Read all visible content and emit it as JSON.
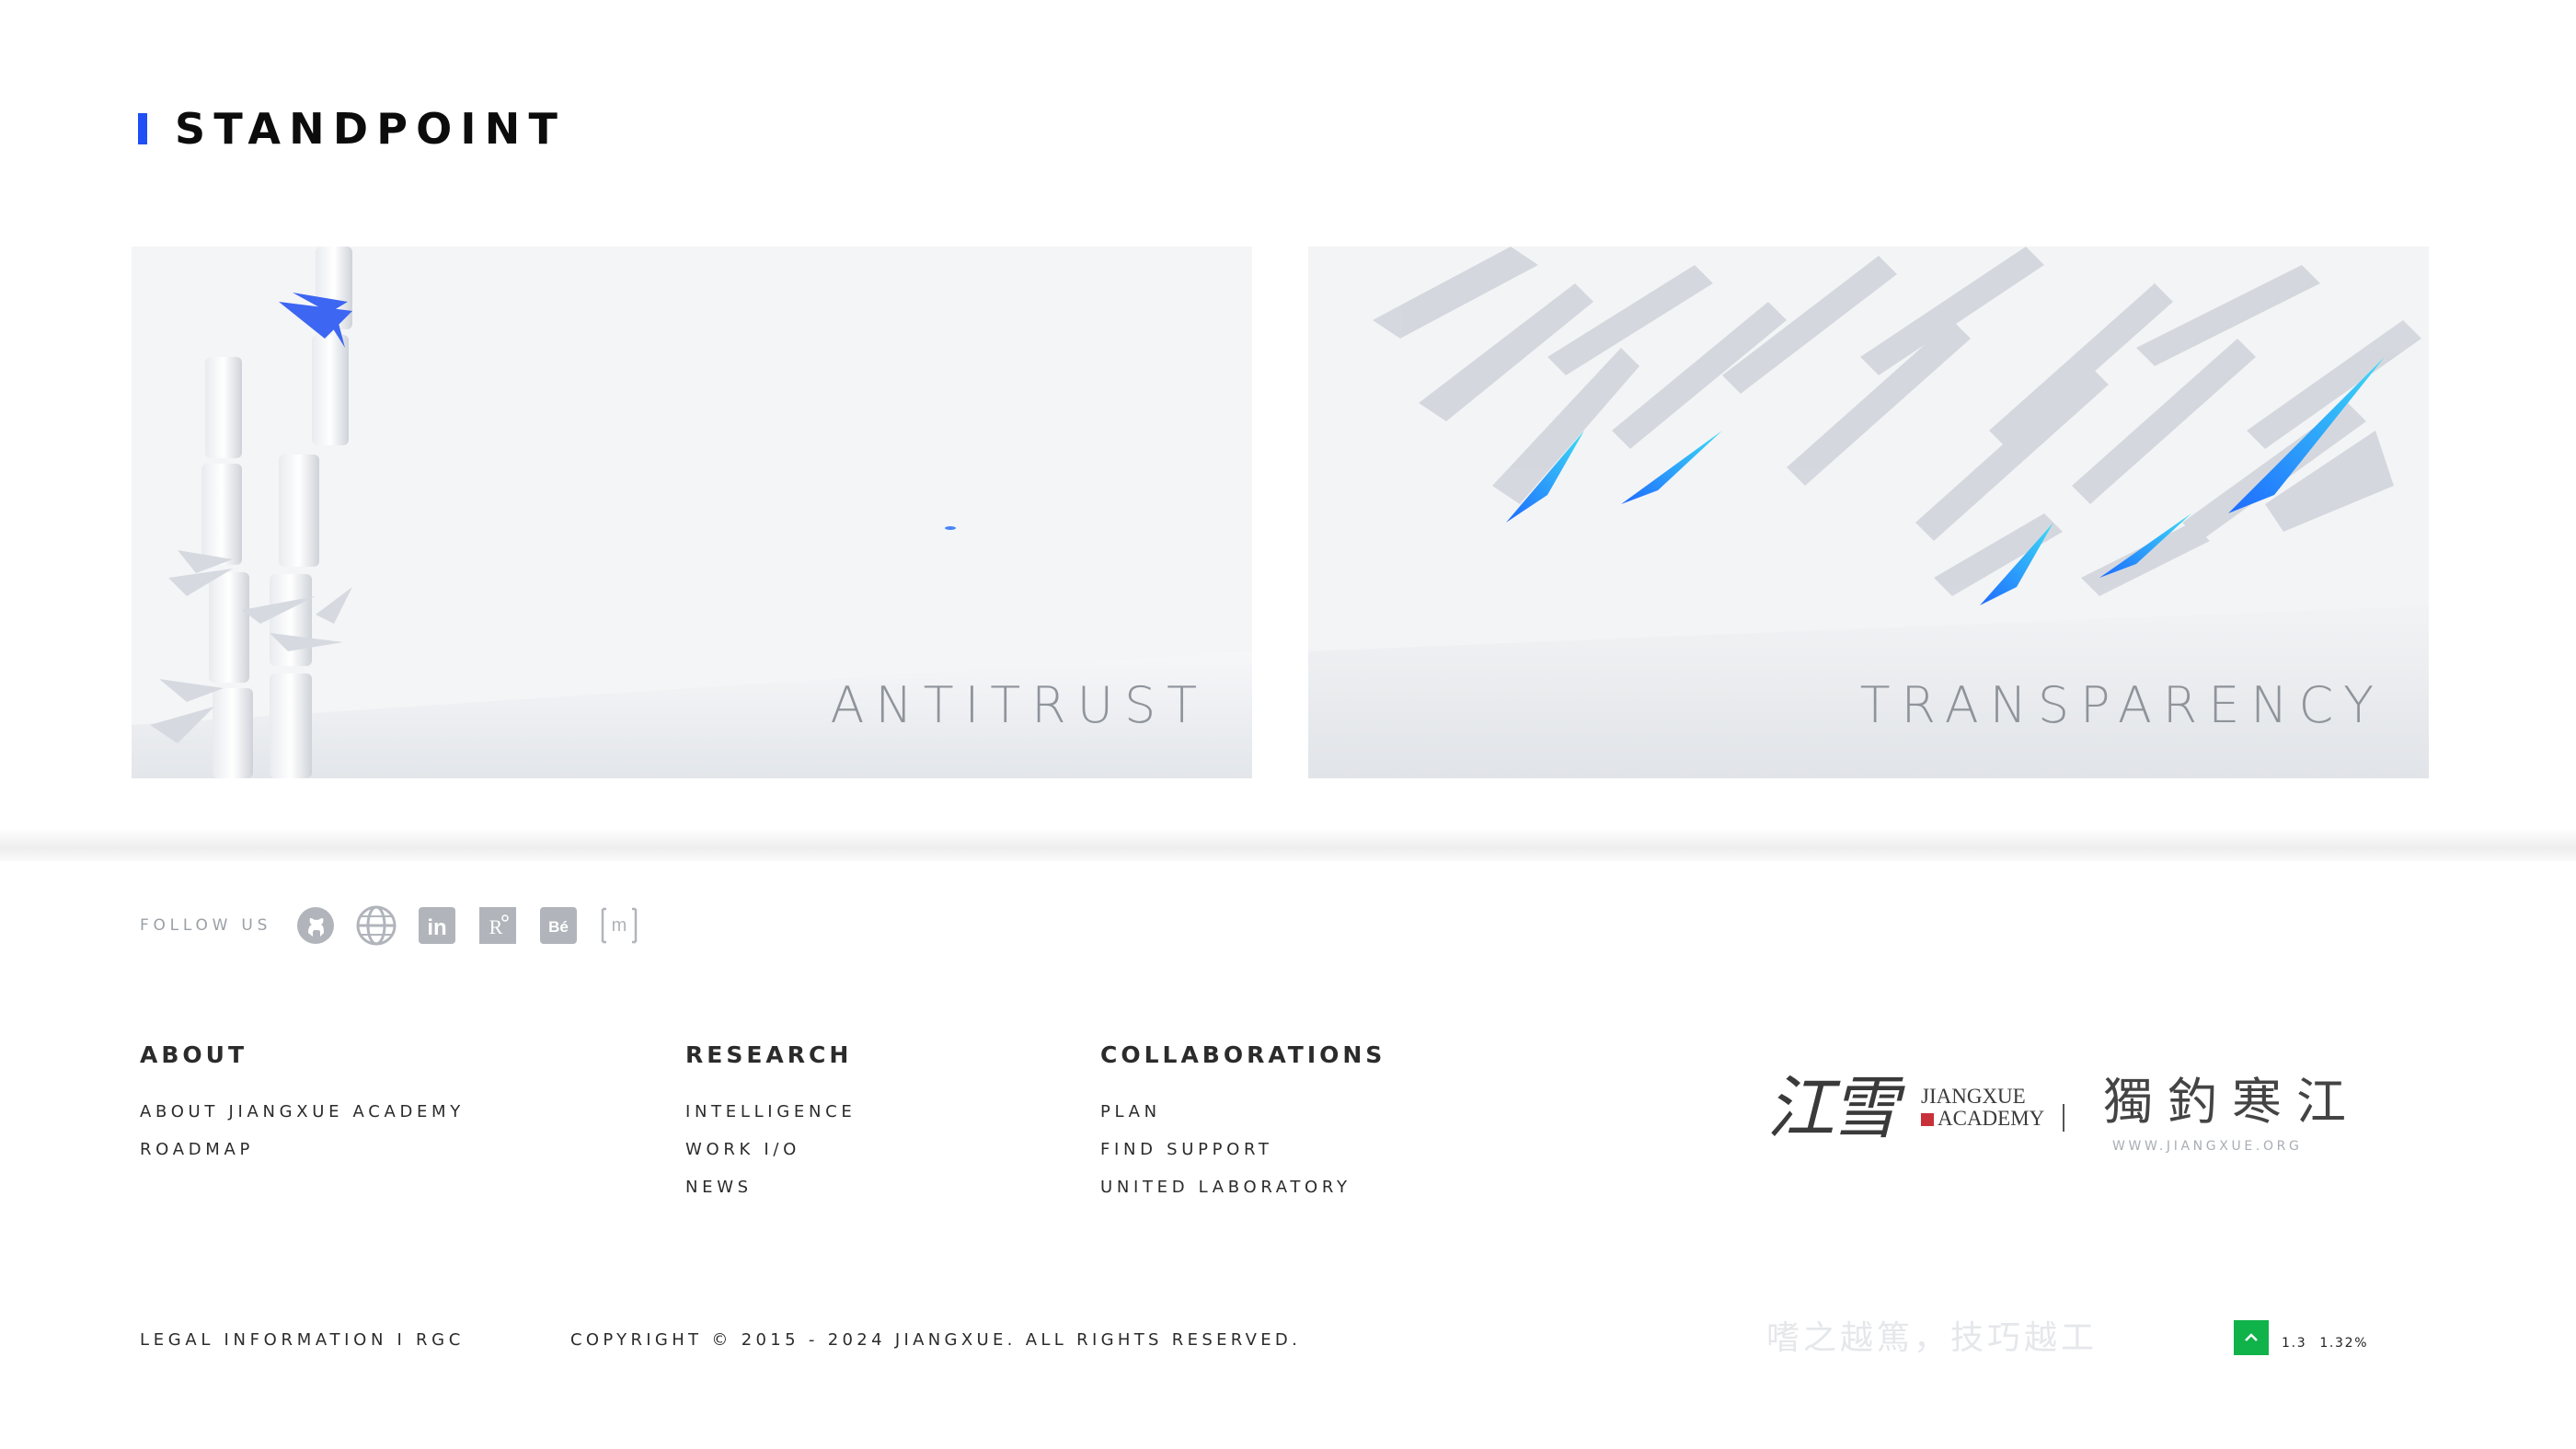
{
  "section": {
    "title": "STANDPOINT"
  },
  "cards": [
    {
      "label": "ANTITRUST"
    },
    {
      "label": "TRANSPARENCY"
    }
  ],
  "social": {
    "label": "FOLLOW US",
    "icons": [
      "github-icon",
      "globe-icon",
      "linkedin-icon",
      "researchgate-icon",
      "behance-icon",
      "medium-icon"
    ],
    "icon_text": {
      "linkedin": "in",
      "researchgate": "R",
      "behance": "Bé",
      "medium": "m"
    }
  },
  "footer": {
    "about": {
      "heading": "ABOUT",
      "links": [
        "ABOUT JIANGXUE ACADEMY",
        "ROADMAP"
      ]
    },
    "research": {
      "heading": "RESEARCH",
      "links": [
        "INTELLIGENCE",
        "WORK I/O",
        "NEWS"
      ]
    },
    "collaborations": {
      "heading": "COLLABORATIONS",
      "links": [
        "PLAN",
        "FIND SUPPORT",
        "UNITED LABORATORY"
      ]
    }
  },
  "brand": {
    "cn": "江雪",
    "en_line1": "JIANGXUE",
    "en_line2": "ACADEMY",
    "cn2": "獨釣寒江",
    "url": "WWW.JIANGXUE.ORG"
  },
  "bottom": {
    "legal": "LEGAL INFORMATION I RGC",
    "copyright": "COPYRIGHT © 2015 - 2024 JIANGXUE. ALL RIGHTS RESERVED.",
    "motto": "嗜之越篤，技巧越工",
    "stat_a": "1.3",
    "stat_b": "1.32%"
  },
  "colors": {
    "accent": "#1f4ff5",
    "top_button": "#10b24a",
    "card_bg": "#f1f3f5"
  }
}
